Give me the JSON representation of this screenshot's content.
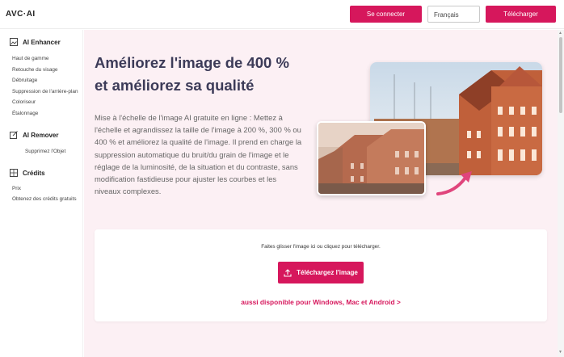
{
  "header": {
    "logo": "AVC·AI",
    "login_label": "Se connecter",
    "language_value": "Français",
    "download_label": "Télécharger"
  },
  "sidebar": {
    "sections": [
      {
        "title": "AI Enhancer",
        "icon": "image-enhance-icon",
        "items": [
          "Haut de gamme",
          "Retouche du visage",
          "Débruitage",
          "Suppression de l'arrière-plan",
          "Coloriseur",
          "Étalonnage"
        ]
      },
      {
        "title": "AI Remover",
        "icon": "edit-icon",
        "items": [
          "Supprimez l'Objet"
        ]
      },
      {
        "title": "Crédits",
        "icon": "credits-icon",
        "items": [
          "Prix",
          "Obtenez des crédits gratuits"
        ]
      }
    ]
  },
  "hero": {
    "title_line1": "Améliorez l'image de 400 %",
    "title_line2": "et améliorez sa qualité",
    "description": "Mise à l'échelle de l'image AI gratuite en ligne : Mettez à l'échelle et agrandissez la taille de l'image à 200 %, 300 % ou 400 % et améliorez la qualité de l'image. Il prend en charge la suppression automatique du bruit/du grain de l'image et le réglage de la luminosité, de la situation et du contraste, sans modification fastidieuse pour ajuster les courbes et les niveaux complexes."
  },
  "upload": {
    "drop_text": "Faites glisser l'image ici ou cliquez pour télécharger.",
    "button_label": "Téléchargez l'image",
    "availability_link": "aussi disponible pour Windows, Mac et Android >"
  },
  "colors": {
    "accent": "#d6175c",
    "title": "#3c3b58",
    "main_bg": "#fcf0f4"
  }
}
